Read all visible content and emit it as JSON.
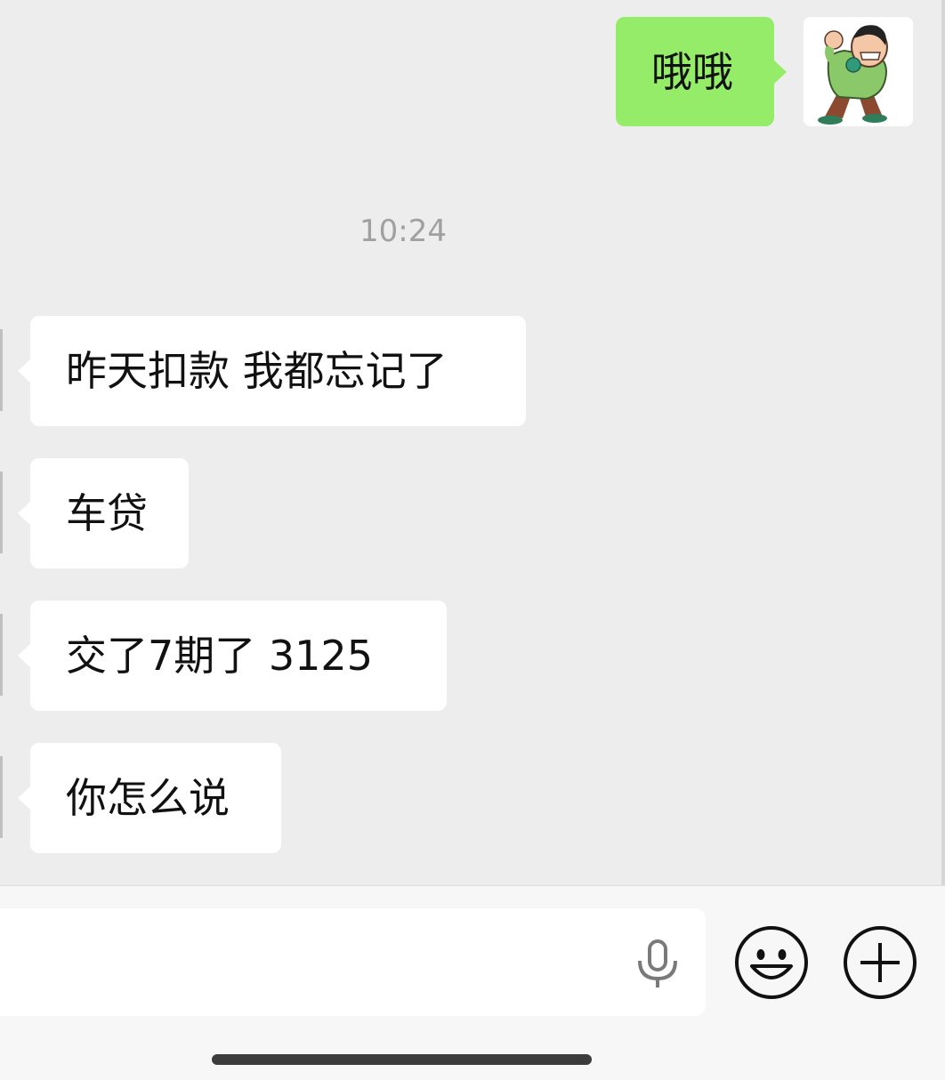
{
  "messages": {
    "sent": [
      {
        "text": "哦哦"
      }
    ],
    "timestamp": "10:24",
    "received": [
      {
        "text": "昨天扣款 我都忘记了"
      },
      {
        "text": "车贷"
      },
      {
        "text": "交了7期了 3125"
      },
      {
        "text": "你怎么说"
      }
    ]
  },
  "icons": {
    "avatar": "cartoon-avatar-icon",
    "voice": "microphone-icon",
    "emoji": "smiley-icon",
    "more": "plus-icon"
  },
  "colors": {
    "background": "#ededed",
    "sent_bubble": "#95ec69",
    "received_bubble": "#ffffff",
    "timestamp_text": "#a0a0a0",
    "input_bar": "#f7f7f7"
  }
}
